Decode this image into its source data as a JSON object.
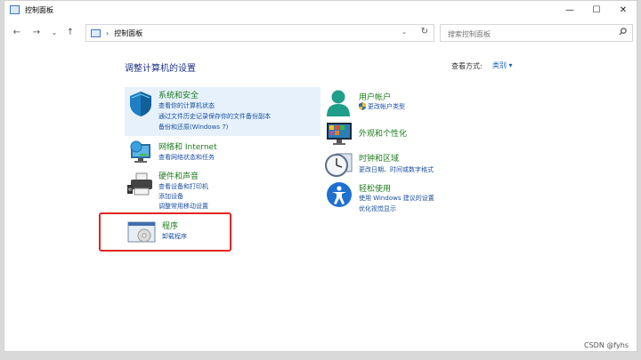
{
  "window": {
    "title": "控制面板",
    "controls": {
      "minimize": "—",
      "maximize": "☐",
      "close": "✕"
    }
  },
  "nav": {
    "back": "←",
    "forward": "→",
    "recent": "⌄",
    "up": "↑",
    "address_sep": "›",
    "address_text": "控制面板",
    "address_dropdown": "⌄",
    "refresh": "↻",
    "search_placeholder": "搜索控制面板"
  },
  "main": {
    "heading": "调整计算机的设置",
    "view_by_label": "查看方式:",
    "view_by_value": "类别 ▾"
  },
  "categories": {
    "system": {
      "title": "系统和安全",
      "links": [
        "查看你的计算机状态",
        "通过文件历史记录保存你的文件备份副本",
        "备份和还原(Windows 7)"
      ]
    },
    "network": {
      "title": "网络和 Internet",
      "links": [
        "查看网络状态和任务"
      ]
    },
    "hardware": {
      "title": "硬件和声音",
      "links": [
        "查看设备和打印机",
        "添加设备",
        "调整常用移动设置"
      ]
    },
    "programs": {
      "title": "程序",
      "links": [
        "卸载程序"
      ]
    },
    "users": {
      "title": "用户帐户",
      "links": [
        "更改帐户类型"
      ]
    },
    "appearance": {
      "title": "外观和个性化",
      "links": []
    },
    "clock": {
      "title": "时钟和区域",
      "links": [
        "更改日期、时间或数字格式"
      ]
    },
    "ease": {
      "title": "轻松使用",
      "links": [
        "使用 Windows 建议的设置",
        "优化视觉显示"
      ]
    }
  },
  "colors": {
    "heading": "#1e3287",
    "category_title": "#1e7a1e",
    "link": "#1a4fa0",
    "highlight": "#e6f1fb",
    "annotation_box": "#e02525"
  },
  "watermark": "CSDN @fyhs"
}
